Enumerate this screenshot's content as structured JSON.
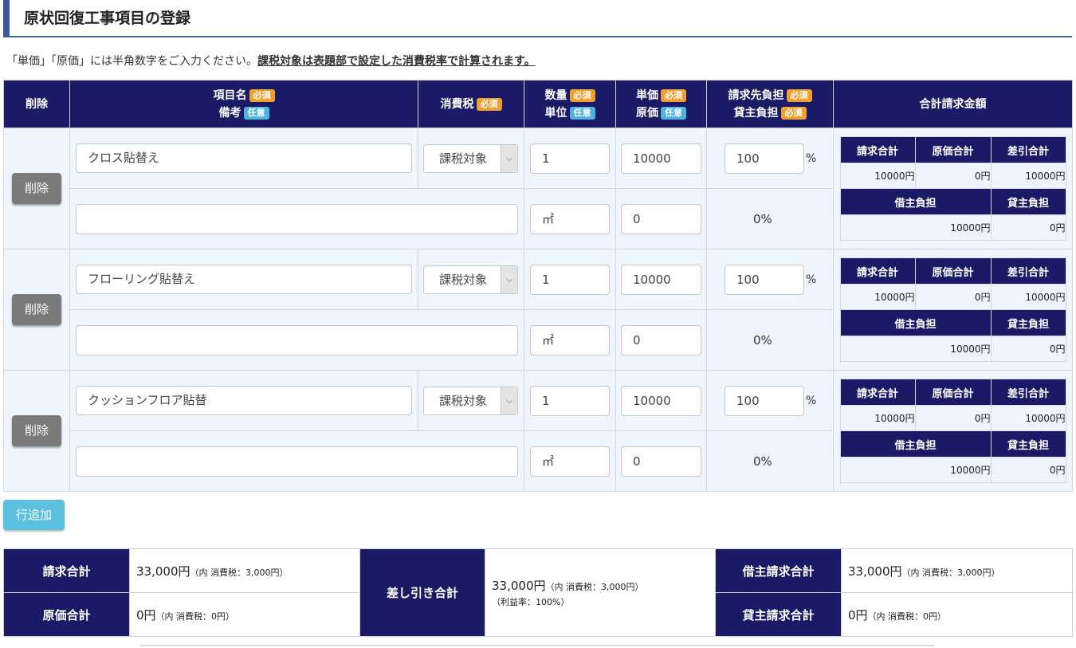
{
  "title": "原状回復工事項目の登録",
  "notice": {
    "plain": "「単価」「原価」には半角数字をご入力ください。",
    "bold": "課税対象は表題部で設定した消費税率で計算されます。"
  },
  "badges": {
    "required": "必須",
    "optional": "任意"
  },
  "headers": {
    "delete": "削除",
    "item_name": "項目名",
    "remarks": "備考",
    "tax": "消費税",
    "quantity": "数量",
    "unit": "単位",
    "unit_price": "単価",
    "cost": "原価",
    "billing_share": "請求先負担",
    "landlord_share": "貸主負担",
    "total": "合計請求金額"
  },
  "summary_labels": {
    "billed_total": "請求合計",
    "cost_total": "原価合計",
    "diff_total": "差引合計",
    "tenant_share": "借主負担",
    "landlord_share": "貸主負担"
  },
  "rows": [
    {
      "delete_label": "削除",
      "item_name": "クロス貼替え",
      "tax": "課税対象",
      "quantity": "1",
      "unit_price": "10000",
      "billing_pct": "100",
      "pct_sign": "%",
      "remarks": "",
      "unit": "㎡",
      "cost": "0",
      "landlord_pct": "0%",
      "sum": {
        "billed": "10000円",
        "cost": "0円",
        "diff": "10000円",
        "tenant": "10000円",
        "landlord": "0円"
      }
    },
    {
      "delete_label": "削除",
      "item_name": "フローリング貼替え",
      "tax": "課税対象",
      "quantity": "1",
      "unit_price": "10000",
      "billing_pct": "100",
      "pct_sign": "%",
      "remarks": "",
      "unit": "㎡",
      "cost": "0",
      "landlord_pct": "0%",
      "sum": {
        "billed": "10000円",
        "cost": "0円",
        "diff": "10000円",
        "tenant": "10000円",
        "landlord": "0円"
      }
    },
    {
      "delete_label": "削除",
      "item_name": "クッションフロア貼替",
      "tax": "課税対象",
      "quantity": "1",
      "unit_price": "10000",
      "billing_pct": "100",
      "pct_sign": "%",
      "remarks": "",
      "unit": "㎡",
      "cost": "0",
      "landlord_pct": "0%",
      "sum": {
        "billed": "10000円",
        "cost": "0円",
        "diff": "10000円",
        "tenant": "10000円",
        "landlord": "0円"
      }
    }
  ],
  "add_row_label": "行追加",
  "totals": {
    "billed_label": "請求合計",
    "billed_value": "33,000円",
    "billed_note": "（内 消費税：3,000円）",
    "cost_label": "原価合計",
    "cost_value": "0円",
    "cost_note": "（内 消費税：0円）",
    "diff_label": "差し引き合計",
    "diff_value": "33,000円",
    "diff_note": "（内 消費税：3,000円）",
    "profit_note": "（利益率：100%）",
    "tenant_label": "借主請求合計",
    "tenant_value": "33,000円",
    "tenant_note": "（内 消費税：3,000円）",
    "landlord_label": "貸主請求合計",
    "landlord_value": "0円",
    "landlord_note": "（内 消費税：0円）"
  },
  "colors": {
    "header_navy": "#1a1a66",
    "required_badge": "#f0a030",
    "optional_badge": "#4db4e0",
    "row_bg": "#eef5fc",
    "add_button": "#5bc0de"
  }
}
